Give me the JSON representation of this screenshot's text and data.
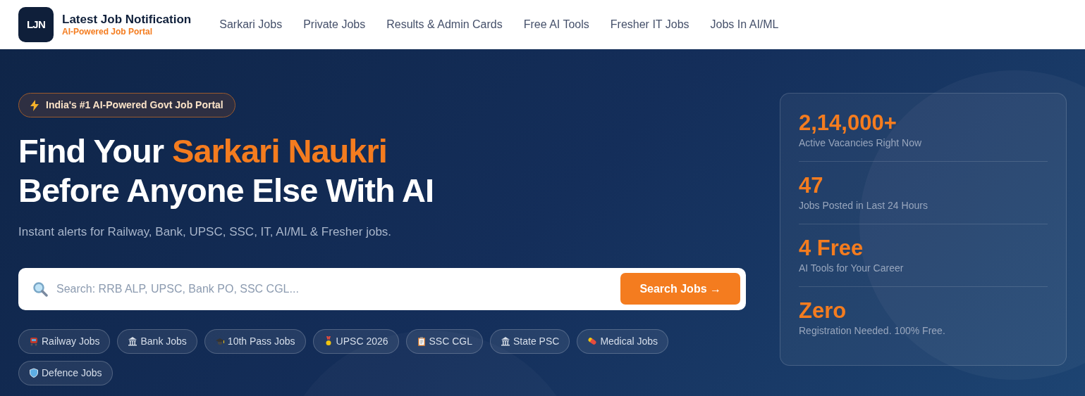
{
  "brand": {
    "logo": "LJN",
    "title": "Latest Job Notification",
    "tagline": "AI-Powered Job Portal"
  },
  "nav": [
    "Sarkari Jobs",
    "Private Jobs",
    "Results & Admin Cards",
    "Free AI Tools",
    "Fresher IT Jobs",
    "Jobs In AI/ML"
  ],
  "hero": {
    "badge": "India's #1 AI-Powered Govt Job Portal",
    "heading_plain": "Find Your ",
    "heading_highlight": "Sarkari Naukri",
    "heading_line2": "Before Anyone Else With AI",
    "subtitle": "Instant alerts for Railway, Bank, UPSC, SSC, IT, AI/ML & Fresher jobs.",
    "search": {
      "placeholder": "Search: RRB ALP, UPSC, Bank PO, SSC CGL...",
      "button": "Search Jobs →"
    },
    "chips": [
      "Railway Jobs",
      "Bank Jobs",
      "10th Pass Jobs",
      "UPSC 2026",
      "SSC CGL",
      "State PSC",
      "Medical Jobs",
      "Defence Jobs"
    ]
  },
  "stats": [
    {
      "value": "2,14,000+",
      "label": "Active Vacancies Right Now"
    },
    {
      "value": "47",
      "label": "Jobs Posted in Last 24 Hours"
    },
    {
      "value": "4 Free",
      "label": "AI Tools for Your Career"
    },
    {
      "value": "Zero",
      "label": "Registration Needed. 100% Free."
    }
  ]
}
